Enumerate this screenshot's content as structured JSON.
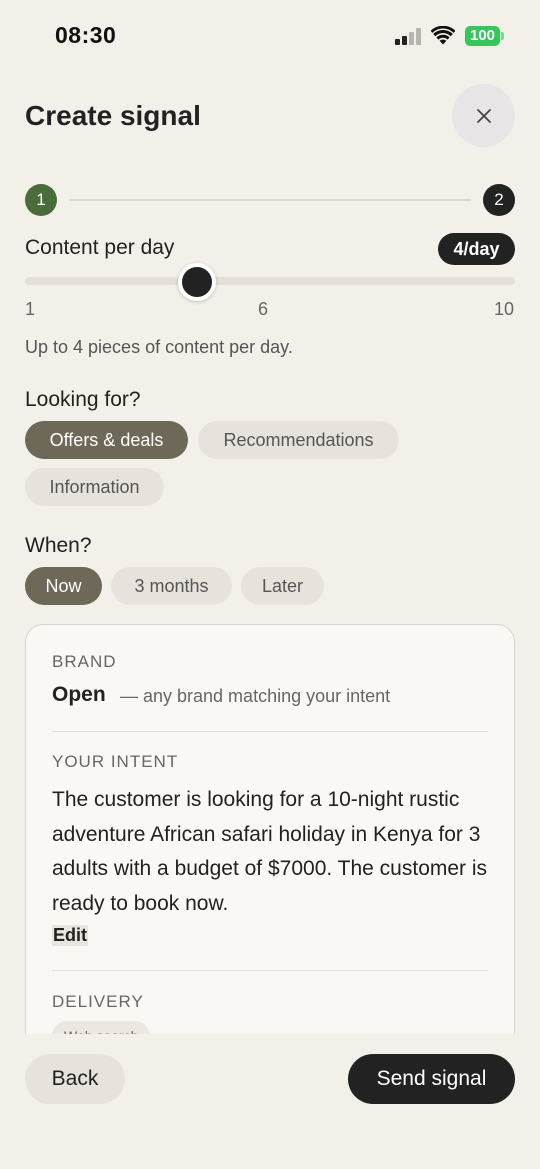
{
  "status_bar": {
    "time": "08:30",
    "battery": "100"
  },
  "header": {
    "title": "Create signal",
    "close_icon": "close-icon"
  },
  "stepper": {
    "steps": [
      "1",
      "2"
    ],
    "current_step": 1
  },
  "content_per_day": {
    "label": "Content per day",
    "badge": "4/day",
    "min_label": "1",
    "mid_label": "6",
    "max_label": "10",
    "min": 1,
    "max": 10,
    "value": 4,
    "helper": "Up to 4 pieces of content per day."
  },
  "looking_for": {
    "label": "Looking for?",
    "options": [
      "Offers & deals",
      "Recommendations",
      "Information"
    ],
    "selected": "Offers & deals"
  },
  "when": {
    "label": "When?",
    "options": [
      "Now",
      "3 months",
      "Later"
    ],
    "selected": "Now"
  },
  "summary_card": {
    "brand_label": "BRAND",
    "brand_value": "Open",
    "brand_note": "— any brand matching your intent",
    "intent_label": "YOUR INTENT",
    "intent_text": "The customer is looking for a 10-night rustic adventure African safari holiday in Kenya for 3 adults with a budget of $7000. The customer is ready to book now.",
    "edit_label": "Edit",
    "delivery_label": "DELIVERY",
    "delivery_value": "Web search"
  },
  "footer": {
    "back_label": "Back",
    "send_label": "Send signal"
  },
  "colors": {
    "background": "#f3f0ea",
    "step_done": "#4a6b3a",
    "selected_chip": "#6e6858",
    "primary_button": "#222222",
    "battery": "#35c759"
  }
}
